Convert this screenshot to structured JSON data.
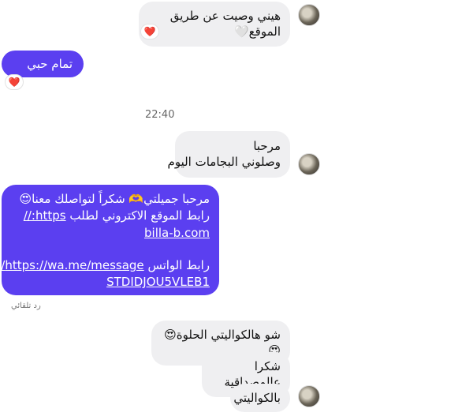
{
  "conversation": {
    "msg1": {
      "text": "هيني وصيت عن طريق الموقع🤍",
      "reaction": "❤️"
    },
    "msg2": {
      "text": "تمام حبي",
      "reaction": "❤️"
    },
    "timestamp": "22:40",
    "msg3": {
      "line1": "مرحبا",
      "line2": "وصلوني البجامات اليوم"
    },
    "auto_reply": {
      "line1": "مرحبا جميلتي🫶 شكراً لتواصلك معنا😍",
      "line2_text": "رابط الموقع الاكتروني لطلب",
      "line2_link": "https://",
      "line3_link": "billa-b.com",
      "line4_text": "رابط الواتس",
      "line4_link": "https://wa.me/message/",
      "line5_link": "STDIDJOU5VLEB1"
    },
    "auto_reply_label": "رد تلقائي",
    "msg4": {
      "text": "شو هالكواليتي الحلوة😍😍"
    },
    "msg5": {
      "text": "شكرا عالمصداقية"
    },
    "msg6": {
      "text": "بالكواليتي"
    }
  },
  "colors": {
    "outgoing": "#5b3ff0",
    "incoming": "#efeff1",
    "reaction": "#e0245e"
  }
}
